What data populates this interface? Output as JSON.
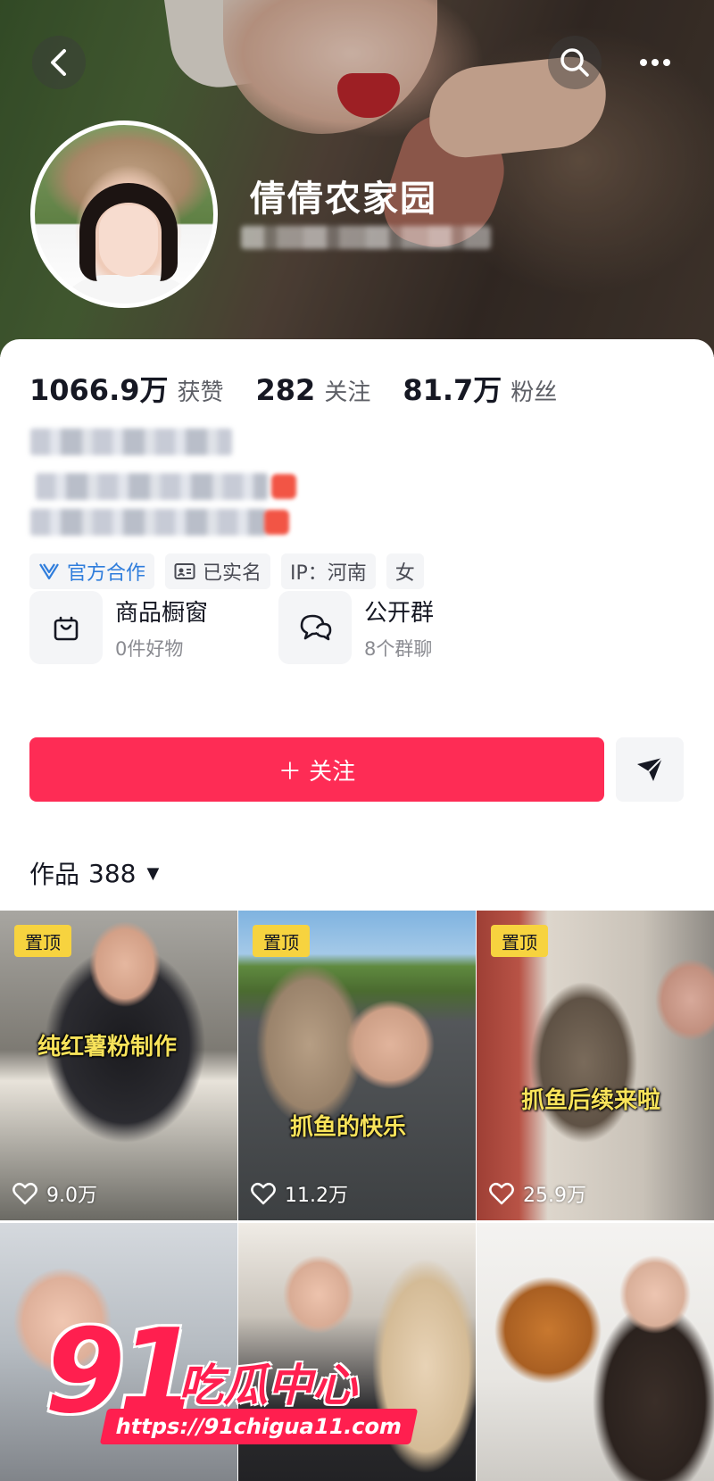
{
  "profile": {
    "nickname": "倩倩农家园"
  },
  "stats": [
    {
      "value": "1066.9万",
      "label": "获赞"
    },
    {
      "value": "282",
      "label": "关注"
    },
    {
      "value": "81.7万",
      "label": "粉丝"
    }
  ],
  "tags": [
    {
      "label": "官方合作",
      "icon": "official-partner-icon"
    },
    {
      "label": "已实名",
      "icon": "id-card-icon"
    },
    {
      "label": "IP：河南"
    },
    {
      "label": "女"
    }
  ],
  "services": {
    "shop": {
      "title": "商品橱窗",
      "subtitle": "0件好物",
      "icon": "shopping-bag-icon"
    },
    "group": {
      "title": "公开群",
      "subtitle": "8个群聊",
      "icon": "chat-bubbles-icon"
    }
  },
  "actions": {
    "follow_label": "＋ 关注",
    "share_icon": "paper-plane-icon"
  },
  "works": {
    "label": "作品",
    "count": "388",
    "caret": "▼"
  },
  "videos": [
    {
      "pinned": "置顶",
      "caption": "纯红薯粉制作",
      "likes": "9.0万"
    },
    {
      "pinned": "置顶",
      "caption": "抓鱼的快乐",
      "likes": "11.2万"
    },
    {
      "pinned": "置顶",
      "caption": "抓鱼后续来啦",
      "likes": "25.9万"
    },
    {},
    {},
    {}
  ],
  "watermark": {
    "number": "91",
    "text": "吃瓜中心",
    "url": "https://91chigua11.com"
  },
  "colors": {
    "accent": "#fe2c55",
    "pin_badge": "#f7d33f",
    "official_tag": "#2f7ddc",
    "watermark": "#ff1f4f"
  }
}
